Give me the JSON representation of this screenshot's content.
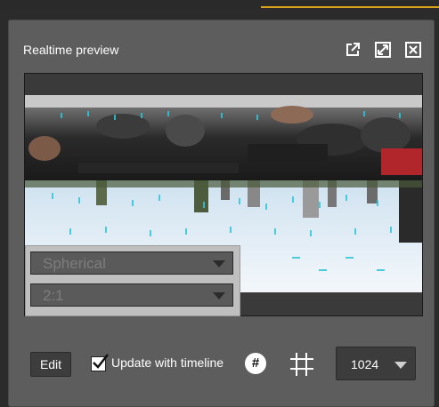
{
  "window": {
    "title": "Realtime preview"
  },
  "icons": {
    "popout": "external-link-icon",
    "expand": "expand-icon",
    "close": "close-icon",
    "grid": "grid-icon"
  },
  "projection": {
    "selected": "Spherical"
  },
  "aspect": {
    "selected": "2:1"
  },
  "controls": {
    "edit_label": "Edit",
    "update_with_timeline_label": "Update with timeline",
    "update_with_timeline_checked": true,
    "hash_label": "#",
    "resolution_selected": "1024"
  },
  "colors": {
    "accent": "#d9a21b",
    "panel": "#5d5d5d",
    "overlay_dots": "#2fc6d8"
  }
}
